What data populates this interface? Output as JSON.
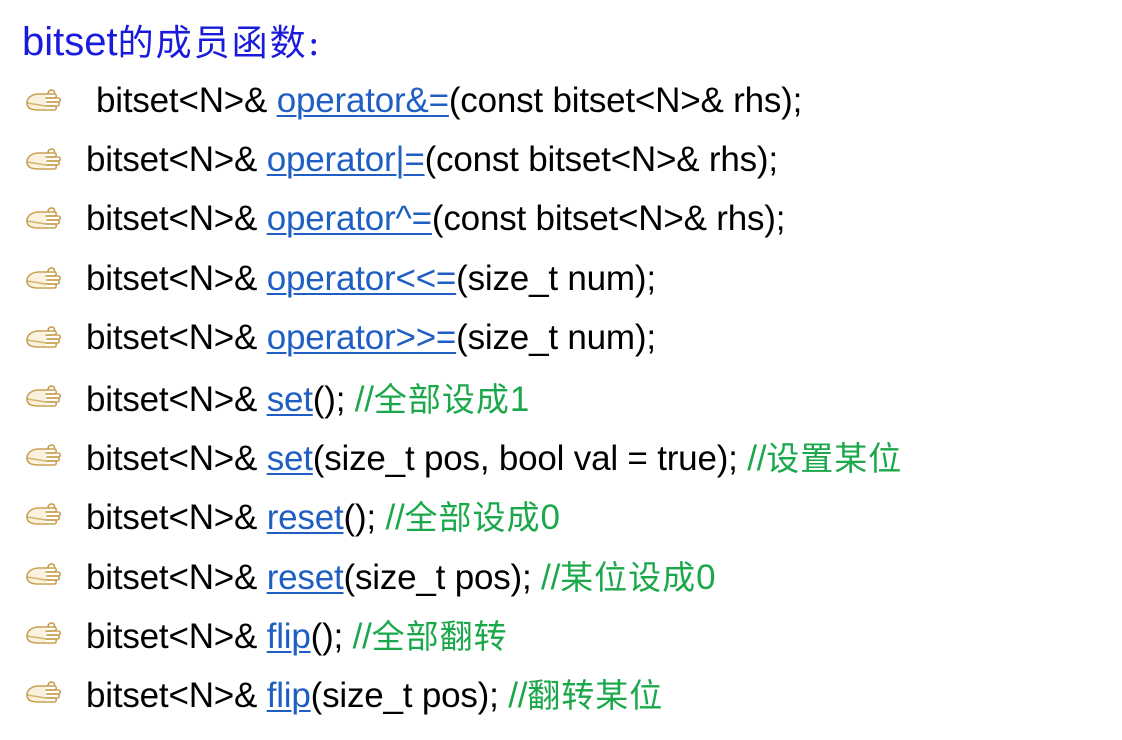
{
  "title": {
    "latin": "bitset",
    "cn": "的成员函数:"
  },
  "rows": [
    {
      "ret": "bitset<N>& ",
      "op": "operator&=",
      "args": "(const bitset<N>& rhs);",
      "comment_prefix": "",
      "comment_cn": "",
      "comment_suffix": ""
    },
    {
      "ret": "bitset<N>& ",
      "op": "operator|=",
      "args": "(const bitset<N>& rhs);",
      "comment_prefix": "",
      "comment_cn": "",
      "comment_suffix": ""
    },
    {
      "ret": "bitset<N>& ",
      "op": "operator^=",
      "args": "(const bitset<N>& rhs);",
      "comment_prefix": "",
      "comment_cn": "",
      "comment_suffix": ""
    },
    {
      "ret": "bitset<N>& ",
      "op": "operator<<=",
      "args": "(size_t num);",
      "comment_prefix": "",
      "comment_cn": "",
      "comment_suffix": ""
    },
    {
      "ret": "bitset<N>& ",
      "op": "operator>>=",
      "args": "(size_t num);",
      "comment_prefix": "",
      "comment_cn": "",
      "comment_suffix": ""
    },
    {
      "ret": "bitset<N>& ",
      "op": "set",
      "args": "(); ",
      "comment_prefix": "//",
      "comment_cn": "全部设成",
      "comment_suffix": "1"
    },
    {
      "ret": "bitset<N>& ",
      "op": "set",
      "args": "(size_t pos, bool val = true); ",
      "comment_prefix": "//",
      "comment_cn": "设置某位",
      "comment_suffix": ""
    },
    {
      "ret": "bitset<N>& ",
      "op": "reset",
      "args": "(); ",
      "comment_prefix": "//",
      "comment_cn": "全部设成",
      "comment_suffix": "0"
    },
    {
      "ret": "bitset<N>& ",
      "op": "reset",
      "args": "(size_t pos); ",
      "comment_prefix": "//",
      "comment_cn": "某位设成",
      "comment_suffix": "0"
    },
    {
      "ret": "bitset<N>& ",
      "op": "flip",
      "args": "(); ",
      "comment_prefix": "//",
      "comment_cn": "全部翻转",
      "comment_suffix": ""
    },
    {
      "ret": "bitset<N>& ",
      "op": "flip",
      "args": "(size_t pos); ",
      "comment_prefix": "//",
      "comment_cn": "翻转某位",
      "comment_suffix": ""
    }
  ],
  "colors": {
    "title": "#1a1adc",
    "link": "#1f5fc4",
    "comment": "#1aa84a",
    "text": "#000000"
  },
  "icons": {
    "bullet": "pointing-hand-icon"
  }
}
